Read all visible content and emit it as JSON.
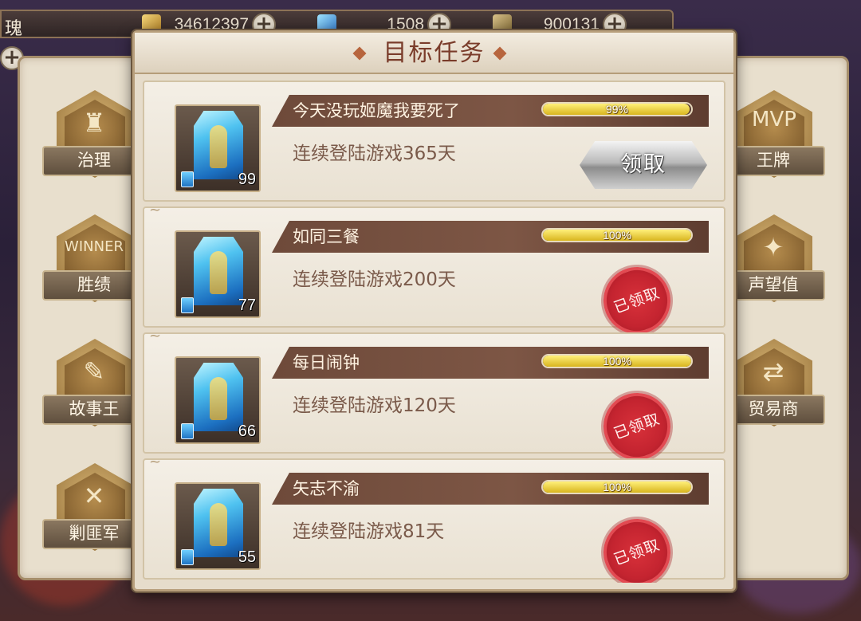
{
  "topbar": {
    "title": "瑰",
    "resources": [
      {
        "icon": "gold-bar-icon",
        "value": "34612397"
      },
      {
        "icon": "blue-card-icon",
        "value": "1508"
      },
      {
        "icon": "medal-icon",
        "value": "900131"
      }
    ],
    "plus_label": "+"
  },
  "left_badges": [
    {
      "label": "治理",
      "icon": "castle-icon"
    },
    {
      "label": "胜绩",
      "icon": "winner-icon"
    },
    {
      "label": "故事王",
      "icon": "scroll-icon"
    },
    {
      "label": "剿匪军",
      "icon": "crossed-swords-icon"
    }
  ],
  "right_badges": [
    {
      "label": "王牌",
      "icon": "mvp-crown-icon"
    },
    {
      "label": "声望值",
      "icon": "reputation-icon"
    },
    {
      "label": "贸易商",
      "icon": "trade-icon"
    }
  ],
  "right_badge_deco": [
    "MVP",
    "✦",
    "⇄"
  ],
  "left_badge_deco": [
    "♜",
    "WINNER",
    "✎",
    "✕"
  ],
  "dialog": {
    "title": "目标任务"
  },
  "tasks": [
    {
      "name": "今天没玩姬魔我要死了",
      "progress": 0.99,
      "progress_text": "99%",
      "desc": "连续登陆游戏365天",
      "reward_count": "99",
      "status": "claimable",
      "action_label": "领取"
    },
    {
      "name": "如同三餐",
      "progress": 1.0,
      "progress_text": "100%",
      "desc": "连续登陆游戏200天",
      "reward_count": "77",
      "status": "claimed",
      "action_label": "已领取"
    },
    {
      "name": "每日闹钟",
      "progress": 1.0,
      "progress_text": "100%",
      "desc": "连续登陆游戏120天",
      "reward_count": "66",
      "status": "claimed",
      "action_label": "已领取"
    },
    {
      "name": "矢志不渝",
      "progress": 1.0,
      "progress_text": "100%",
      "desc": "连续登陆游戏81天",
      "reward_count": "55",
      "status": "claimed",
      "action_label": "已领取"
    }
  ],
  "colors": {
    "title": "#7a3c2a",
    "banner": "#6e4a3a",
    "progress_fill": "#d8b51e",
    "stamp": "#c42430"
  }
}
